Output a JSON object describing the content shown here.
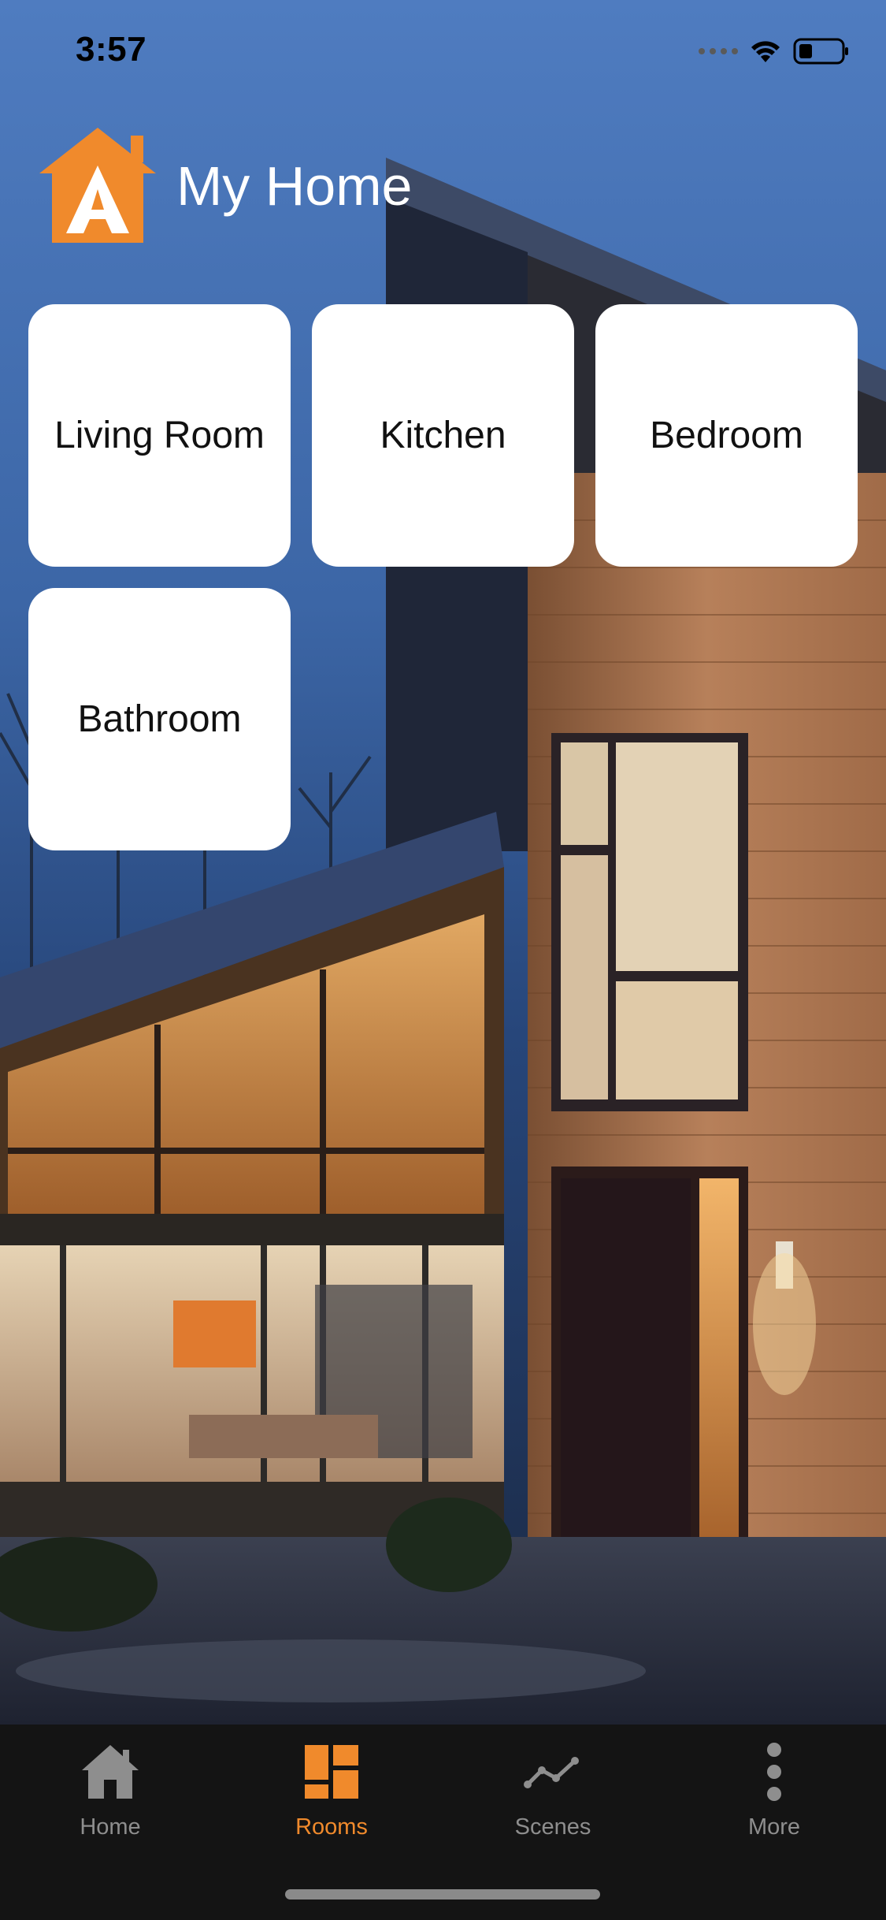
{
  "status_bar": {
    "time": "3:57",
    "icons": [
      "signal-dots-icon",
      "wifi-icon",
      "battery-icon"
    ]
  },
  "header": {
    "logo_icon": "home-logo-icon",
    "title": "My Home"
  },
  "rooms": [
    {
      "label": "Living Room"
    },
    {
      "label": "Kitchen"
    },
    {
      "label": "Bedroom"
    },
    {
      "label": "Bathroom"
    }
  ],
  "tabbar": {
    "tabs": [
      {
        "label": "Home",
        "icon": "house-icon",
        "active": false
      },
      {
        "label": "Rooms",
        "icon": "rooms-grid-icon",
        "active": true
      },
      {
        "label": "Scenes",
        "icon": "scenes-graph-icon",
        "active": false
      },
      {
        "label": "More",
        "icon": "more-dots-icon",
        "active": false
      }
    ]
  },
  "colors": {
    "accent": "#f08a2c",
    "tab_inactive": "#8e8e8e",
    "tabbar_bg": "#141414",
    "tile_bg": "#ffffff"
  }
}
